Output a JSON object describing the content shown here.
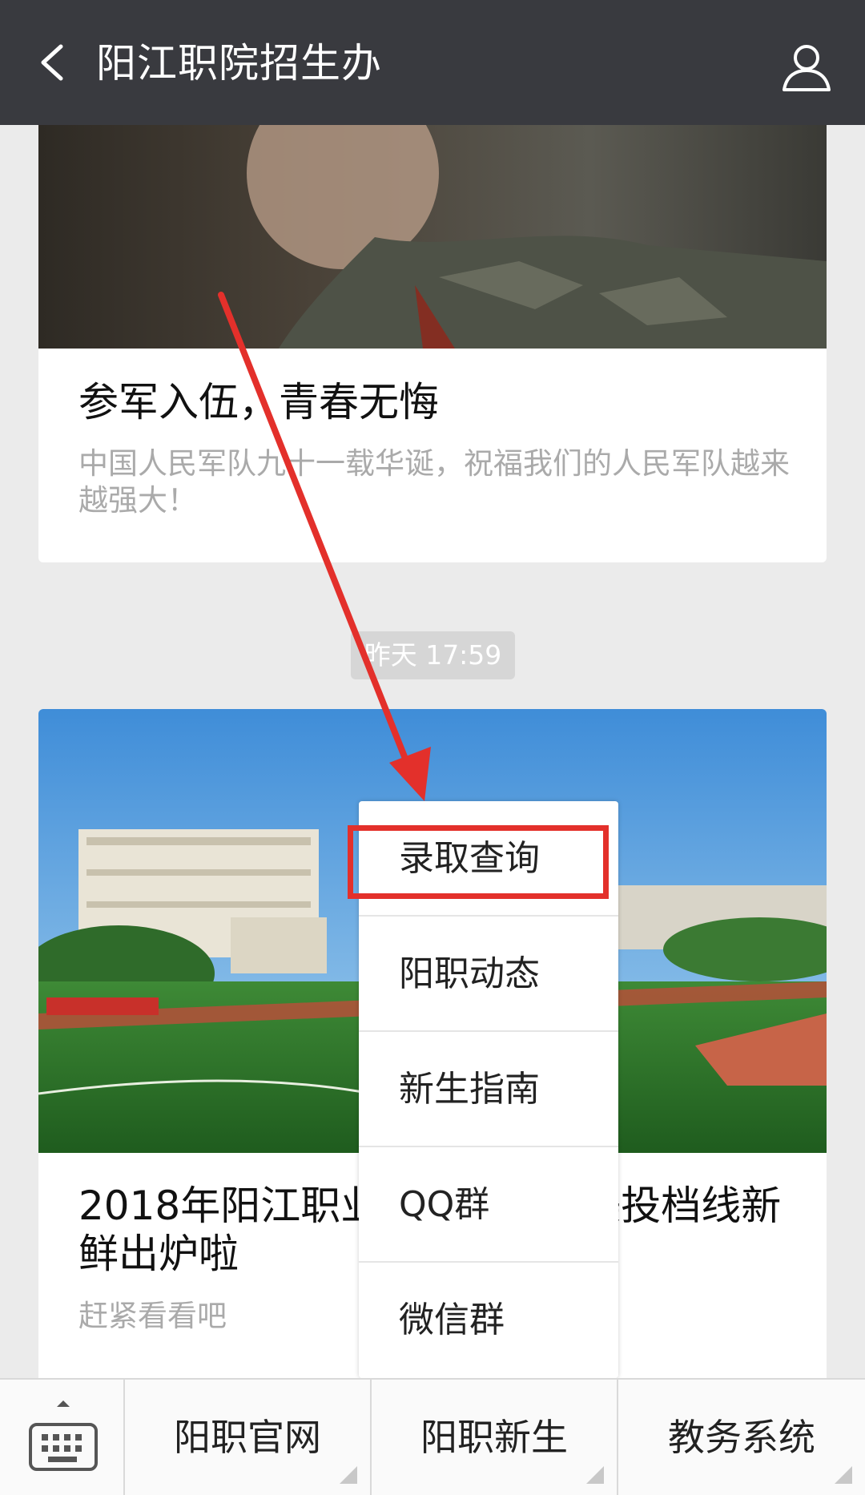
{
  "header": {
    "title": "阳江职院招生办"
  },
  "articles": [
    {
      "title": "参军入伍，青春无悔",
      "description": "中国人民军队九十一载华诞，祝福我们的人民军队越来越强大！"
    },
    {
      "title": "2018年阳江职业技术学院体美投档线新鲜出炉啦",
      "description": "赶紧看看吧"
    }
  ],
  "timestamp": "昨天 17:59",
  "popup_menu": {
    "items": [
      "录取查询",
      "阳职动态",
      "新生指南",
      "QQ群",
      "微信群"
    ],
    "highlighted_index": 0
  },
  "bottom_menu": {
    "items": [
      "阳职官网",
      "阳职新生",
      "教务系统"
    ]
  },
  "colors": {
    "header_bg": "#393a3f",
    "page_bg": "#ebebeb",
    "annotation_red": "#e3302b"
  }
}
